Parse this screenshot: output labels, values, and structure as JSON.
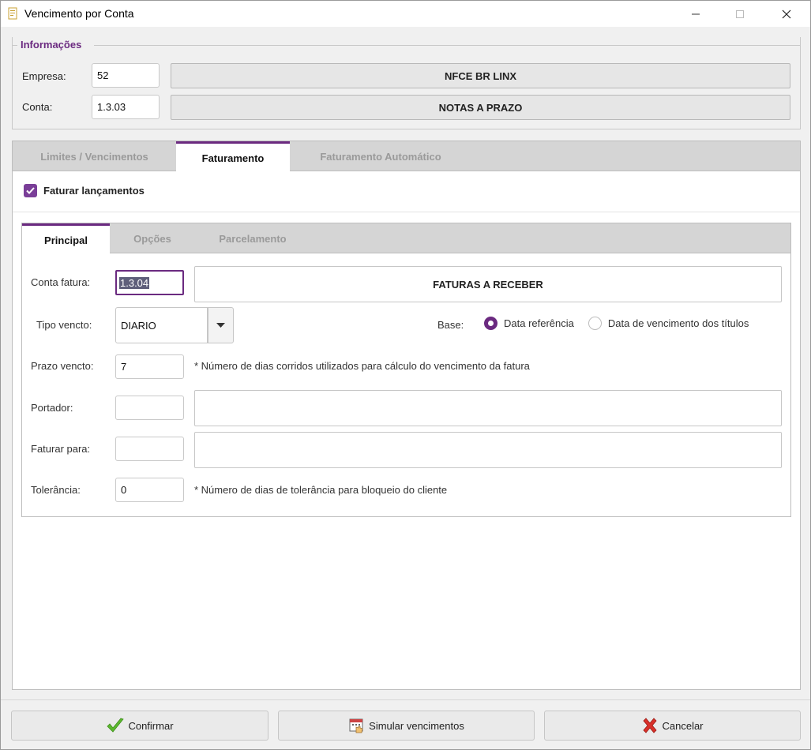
{
  "window": {
    "title": "Vencimento por Conta",
    "icon": "document-icon"
  },
  "info": {
    "group_title": "Informações",
    "empresa_label": "Empresa:",
    "empresa_code": "52",
    "empresa_name": "NFCE BR LINX",
    "conta_label": "Conta:",
    "conta_code": "1.3.03",
    "conta_name": "NOTAS A PRAZO"
  },
  "outer_tabs": [
    {
      "label": "Limites / Vencimentos",
      "active": false
    },
    {
      "label": "Faturamento",
      "active": true
    },
    {
      "label": "Faturamento Automático",
      "active": false
    }
  ],
  "faturar": {
    "label": "Faturar lançamentos",
    "checked": true
  },
  "inner_tabs": [
    {
      "label": "Principal",
      "active": true
    },
    {
      "label": "Opções",
      "active": false
    },
    {
      "label": "Parcelamento",
      "active": false
    }
  ],
  "principal": {
    "conta_fatura_label": "Conta fatura:",
    "conta_fatura_code": "1.3.04",
    "conta_fatura_name": "FATURAS A RECEBER",
    "tipo_vencto_label": "Tipo vencto:",
    "tipo_vencto_value": "DIARIO",
    "base_label": "Base:",
    "base_options": [
      {
        "label": "Data referência",
        "checked": true
      },
      {
        "label": "Data de vencimento dos títulos",
        "checked": false
      }
    ],
    "prazo_label": "Prazo vencto:",
    "prazo_value": "7",
    "prazo_hint": "* Número de dias corridos utilizados para cálculo do vencimento da fatura",
    "portador_label": "Portador:",
    "portador_code": "",
    "portador_name": "",
    "faturar_para_label": "Faturar para:",
    "faturar_para_code": "",
    "faturar_para_name": "",
    "tolerancia_label": "Tolerância:",
    "tolerancia_value": "0",
    "tolerancia_hint": "* Número de dias de tolerância para bloqueio do cliente"
  },
  "buttons": {
    "confirmar": "Confirmar",
    "simular": "Simular vencimentos",
    "cancelar": "Cancelar"
  },
  "colors": {
    "accent": "#6b2a80",
    "confirm_icon": "#5cb82e",
    "cancel_icon": "#d9302a"
  }
}
